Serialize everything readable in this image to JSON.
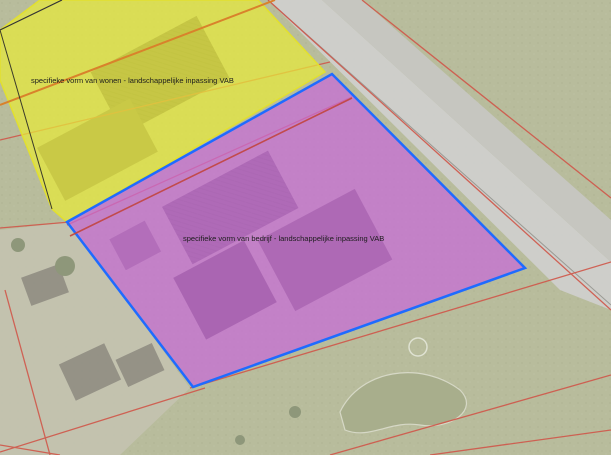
{
  "map": {
    "zones": [
      {
        "id": "wonen",
        "label": "specifieke vorm van wonen - landschappelijke inpassing VAB",
        "fill": "#e8ea3a",
        "stroke": "#e8ea3a"
      },
      {
        "id": "bedrijf",
        "label": "specifieke vorm van bedrijf - landschappelijke inpassing VAB",
        "fill": "#c86bd8",
        "stroke": "#1f6bff"
      }
    ],
    "colors": {
      "parcel_lines": "#d0574a",
      "pipeline_line": "#d9822b",
      "road": "#cfcfcc",
      "grass": "#b8bc9c"
    }
  }
}
